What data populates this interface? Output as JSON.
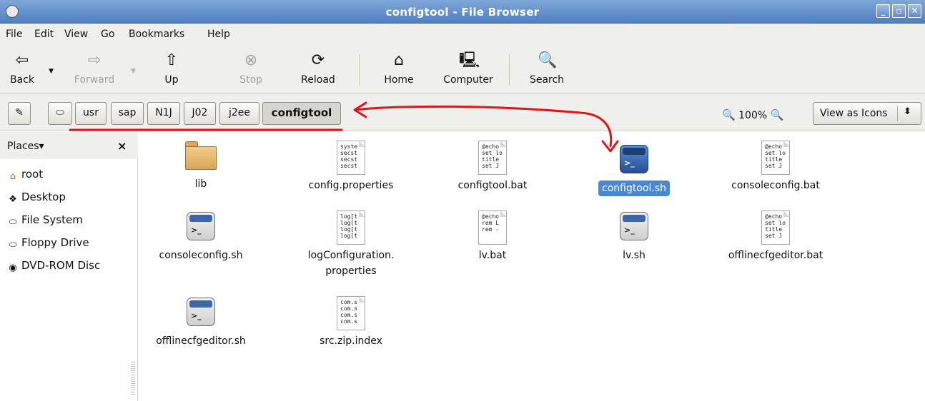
{
  "window": {
    "title": "configtool - File Browser"
  },
  "menu": [
    "File",
    "Edit",
    "View",
    "Go",
    "Bookmarks",
    "Help"
  ],
  "toolbar": {
    "back": "Back",
    "forward": "Forward",
    "up": "Up",
    "stop": "Stop",
    "reload": "Reload",
    "home": "Home",
    "computer": "Computer",
    "search": "Search"
  },
  "path": [
    "usr",
    "sap",
    "N1J",
    "J02",
    "j2ee",
    "configtool"
  ],
  "zoom": {
    "level": "100%"
  },
  "view_mode": "View as Icons",
  "sidebar": {
    "header": "Places",
    "items": [
      {
        "label": "root",
        "icon": "home-folder-icon"
      },
      {
        "label": "Desktop",
        "icon": "desktop-icon"
      },
      {
        "label": "File System",
        "icon": "drive-icon"
      },
      {
        "label": "Floppy Drive",
        "icon": "floppy-icon"
      },
      {
        "label": "DVD-ROM Disc",
        "icon": "dvd-icon"
      }
    ]
  },
  "files": [
    {
      "name": "lib",
      "kind": "folder"
    },
    {
      "name": "config.properties",
      "kind": "text",
      "preview": [
        "syste",
        "secst",
        "secst",
        "secst"
      ]
    },
    {
      "name": "configtool.bat",
      "kind": "text",
      "preview": [
        "@echo",
        "set lo",
        "title",
        "set J"
      ]
    },
    {
      "name": "configtool.sh",
      "kind": "script",
      "selected": true
    },
    {
      "name": "consoleconfig.bat",
      "kind": "text",
      "preview": [
        "@echo",
        "set lo",
        "title",
        "set J"
      ]
    },
    {
      "name": "consoleconfig.sh",
      "kind": "script"
    },
    {
      "name": "logConfiguration.\nproperties",
      "kind": "text",
      "preview": [
        "log[t",
        "log[t",
        "log[t",
        "log[t"
      ]
    },
    {
      "name": "lv.bat",
      "kind": "text",
      "preview": [
        "@echo",
        "",
        "rem L",
        "rem -"
      ]
    },
    {
      "name": "lv.sh",
      "kind": "script"
    },
    {
      "name": "offlinecfgeditor.bat",
      "kind": "text",
      "preview": [
        "@echo",
        "set lo",
        "title",
        "set J"
      ]
    },
    {
      "name": "offlinecfgeditor.sh",
      "kind": "script"
    },
    {
      "name": "src.zip.index",
      "kind": "text",
      "preview": [
        "com.s",
        "com.s",
        "com.s",
        "com.s"
      ]
    }
  ],
  "annotation_color": "#e0141b"
}
